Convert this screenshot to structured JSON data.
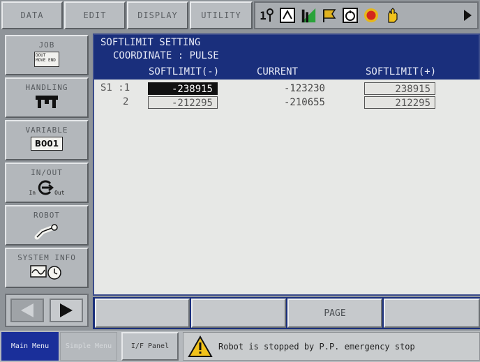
{
  "top_menu": {
    "data": "DATA",
    "edit": "EDIT",
    "display": "DISPLAY",
    "utility": "UTILITY"
  },
  "toolbar": {
    "icons": [
      "tool-number-icon",
      "teach-mode-icon",
      "signal-strength-icon",
      "coordinate-flag-icon",
      "speed-icon",
      "servo-on-icon",
      "hand-icon",
      "next-arrow-icon"
    ],
    "tool_number": "1"
  },
  "side_menu": {
    "job": "JOB",
    "job_icon_text": "DOUT MOVE END",
    "handling": "HANDLING",
    "variable": "VARIABLE",
    "variable_icon_text": "B001",
    "inout": "IN/OUT",
    "inout_in": "In",
    "inout_out": "Out",
    "robot": "ROBOT",
    "system_info": "SYSTEM INFO"
  },
  "screen": {
    "title": "SOFTLIMIT SETTING",
    "coordinate": "COORDINATE : PULSE",
    "col_minus": "SOFTLIMIT(-)",
    "col_current": "CURRENT",
    "col_plus": "SOFTLIMIT(+)",
    "rows": [
      {
        "label": "S1 :1",
        "minus": "-238915",
        "current": "-123230",
        "plus": "238915"
      },
      {
        "label": "2",
        "minus": "-212295",
        "current": "-210655",
        "plus": "212295"
      }
    ]
  },
  "function_bar": {
    "f3": "PAGE"
  },
  "status_bar": {
    "main_menu": "Main Menu",
    "simple_menu": "Simple Menu",
    "ip_panel": "I/F Panel",
    "message": "Robot is stopped by P.P. emergency stop"
  },
  "colors": {
    "screen_bg": "#1a2f7c",
    "content_bg": "#e7e8e6",
    "selected_cell": "#111111",
    "alarm_yellow": "#f2c21a"
  }
}
